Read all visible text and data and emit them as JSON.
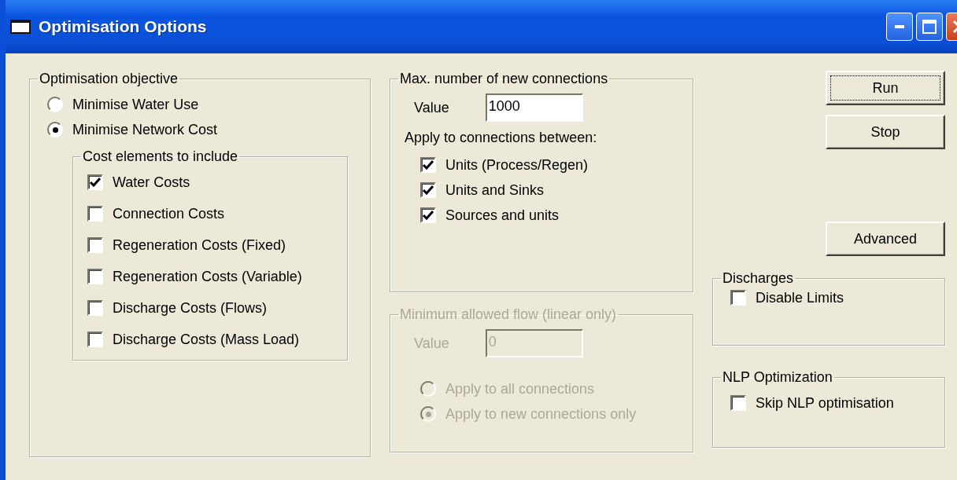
{
  "window": {
    "title": "Optimisation Options"
  },
  "objective": {
    "legend": "Optimisation objective",
    "options": [
      {
        "label": "Minimise Water Use",
        "selected": false
      },
      {
        "label": "Minimise Network Cost",
        "selected": true
      }
    ],
    "cost_elements": {
      "legend": "Cost elements to include",
      "items": [
        {
          "label": "Water Costs",
          "checked": true
        },
        {
          "label": "Connection Costs",
          "checked": false
        },
        {
          "label": "Regeneration Costs (Fixed)",
          "checked": false
        },
        {
          "label": "Regeneration Costs (Variable)",
          "checked": false
        },
        {
          "label": "Discharge Costs (Flows)",
          "checked": false
        },
        {
          "label": "Discharge Costs (Mass Load)",
          "checked": false
        }
      ]
    }
  },
  "max_connections": {
    "legend": "Max. number of new connections",
    "value_label": "Value",
    "value": "1000",
    "apply_label": "Apply to connections between:",
    "items": [
      {
        "label": "Units (Process/Regen)",
        "checked": true
      },
      {
        "label": "Units and Sinks",
        "checked": true
      },
      {
        "label": "Sources and units",
        "checked": true
      }
    ]
  },
  "min_flow": {
    "legend": "Minimum allowed flow (linear only)",
    "disabled": true,
    "value_label": "Value",
    "value": "0",
    "options": [
      {
        "label": "Apply to all connections",
        "selected": false
      },
      {
        "label": "Apply to new connections only",
        "selected": true
      }
    ]
  },
  "buttons": [
    {
      "label": "Run",
      "focused": true
    },
    {
      "label": "Stop",
      "focused": false
    }
  ],
  "advanced_button": {
    "label": "Advanced",
    "focused": false
  },
  "discharges": {
    "legend": "Discharges",
    "items": [
      {
        "label": "Disable Limits",
        "checked": false
      }
    ]
  },
  "nlp": {
    "legend": "NLP Optimization",
    "items": [
      {
        "label": "Skip NLP optimisation",
        "checked": false
      }
    ]
  }
}
